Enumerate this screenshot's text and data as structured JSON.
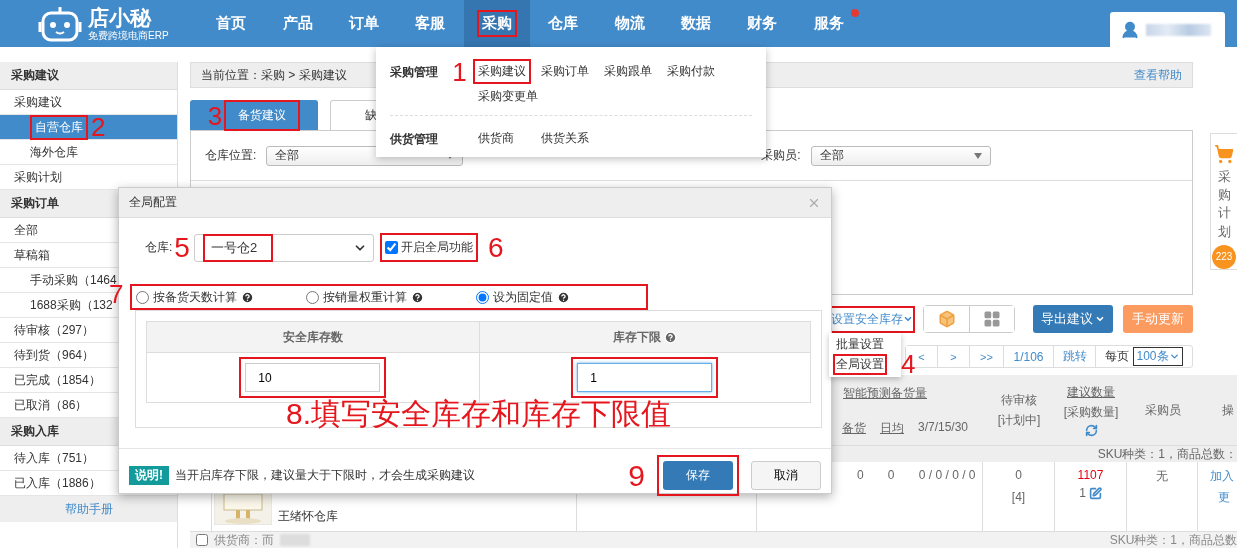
{
  "header": {
    "logo": {
      "name": "店小秘",
      "tagline": "免费跨境电商ERP"
    },
    "nav": [
      {
        "label": "首页",
        "selected": false,
        "annotated": false,
        "dot": false
      },
      {
        "label": "产品",
        "selected": false,
        "annotated": false,
        "dot": false
      },
      {
        "label": "订单",
        "selected": false,
        "annotated": false,
        "dot": false
      },
      {
        "label": "客服",
        "selected": false,
        "annotated": false,
        "dot": false
      },
      {
        "label": "采购",
        "selected": true,
        "annotated": true,
        "dot": false
      },
      {
        "label": "仓库",
        "selected": false,
        "annotated": false,
        "dot": false
      },
      {
        "label": "物流",
        "selected": false,
        "annotated": false,
        "dot": false
      },
      {
        "label": "数据",
        "selected": false,
        "annotated": false,
        "dot": false
      },
      {
        "label": "财务",
        "selected": false,
        "annotated": false,
        "dot": false
      },
      {
        "label": "服务",
        "selected": false,
        "annotated": false,
        "dot": true
      }
    ]
  },
  "nav_menu": {
    "groups": [
      {
        "title": "采购管理",
        "step": "1",
        "items": [
          {
            "label": "采购建议",
            "annotated": true
          },
          {
            "label": "采购订单",
            "annotated": false
          },
          {
            "label": "采购跟单",
            "annotated": false
          },
          {
            "label": "采购付款",
            "annotated": false
          },
          {
            "label": "采购变更单",
            "annotated": false
          }
        ]
      },
      {
        "title": "供货管理",
        "items": [
          {
            "label": "供货商",
            "annotated": false
          },
          {
            "label": "供货关系",
            "annotated": false
          }
        ]
      }
    ]
  },
  "sidebar": {
    "sections": [
      {
        "title": "采购建议",
        "items": [
          {
            "label": "采购建议",
            "selected": false,
            "annotated": false,
            "children": [
              {
                "label": "自营仓库",
                "selected": true,
                "annotated": true,
                "step": "2"
              },
              {
                "label": "海外仓库",
                "selected": false,
                "annotated": false
              }
            ]
          },
          {
            "label": "采购计划",
            "selected": false,
            "annotated": false
          }
        ]
      },
      {
        "title": "采购订单",
        "items": [
          {
            "label": "全部",
            "selected": false,
            "annotated": false
          },
          {
            "label": "草稿箱",
            "selected": false,
            "annotated": false,
            "children": [
              {
                "label": "手动采购（1464",
                "selected": false,
                "annotated": false
              },
              {
                "label": "1688采购（132",
                "selected": false,
                "annotated": false
              }
            ]
          },
          {
            "label": "待审核（297）",
            "selected": false,
            "annotated": false
          },
          {
            "label": "待到货（964）",
            "selected": false,
            "annotated": false
          },
          {
            "label": "已完成（1854）",
            "selected": false,
            "annotated": false
          },
          {
            "label": "已取消（86）",
            "selected": false,
            "annotated": false
          }
        ]
      },
      {
        "title": "采购入库",
        "items": [
          {
            "label": "待入库（751）",
            "selected": false,
            "annotated": false
          },
          {
            "label": "已入库（1886）",
            "selected": false,
            "annotated": false
          }
        ]
      }
    ],
    "help": "帮助手册"
  },
  "breadcrumb": {
    "text": "当前位置：采购 > 采购建议",
    "help": "查看帮助"
  },
  "tabs": [
    {
      "label": "备货建议",
      "selected": true,
      "annotated": true,
      "step": "3"
    },
    {
      "label": "缺",
      "selected": false,
      "annotated": false
    }
  ],
  "filters": [
    {
      "label": "仓库位置:",
      "value": "全部"
    },
    {
      "label": "采购员:",
      "value": "全部"
    }
  ],
  "side_float": {
    "label": "采购计划",
    "badge": "223"
  },
  "toolbar": {
    "safety_stock": {
      "label": "设置安全库存",
      "annotated": true
    },
    "export": "导出建议",
    "refresh": "手动更新"
  },
  "safety_menu": [
    {
      "label": "批量设置",
      "annotated": false
    },
    {
      "label": "全局设置",
      "annotated": true,
      "step": "4"
    }
  ],
  "pagination": {
    "buttons": [
      "<",
      ">",
      ">>"
    ],
    "page": "1/106",
    "jump": "跳转",
    "per_page_label": "每页",
    "per_page": "100条"
  },
  "table": {
    "forecast": {
      "title": "智能预测备货量",
      "subs": [
        "备货",
        "日均",
        "3/7/15/30"
      ]
    },
    "columns": [
      {
        "label": "待审核",
        "sub": "[计划中]",
        "refresh": false,
        "underline": false
      },
      {
        "label": "建议数量",
        "sub": "[采购数量]",
        "refresh": true,
        "underline": true
      },
      {
        "label": "采购员",
        "refresh": false,
        "underline": false
      },
      {
        "label": "操",
        "refresh": false,
        "underline": false
      }
    ],
    "summary": "SKU种类：1，商品总数：",
    "row": {
      "warehouse": "王绪怀仓库",
      "forecast": [
        "0",
        "0",
        "0 / 0 / 0 / 0"
      ],
      "pending": "0",
      "pending_plan": "[4]",
      "suggested": "1107",
      "purchase": "1",
      "buyer": "无",
      "actions": [
        "加入",
        "更"
      ]
    },
    "footer": {
      "checked": false,
      "supplier": "供货商：而",
      "summary": "SKU种类：1，商品总数"
    }
  },
  "dialog": {
    "title": "全局配置",
    "warehouse_label": "仓库:",
    "warehouse_step": "5",
    "warehouse": {
      "value": "一号仓2",
      "annotated": true
    },
    "enable": {
      "label": "开启全局功能",
      "checked": true,
      "annotated": true,
      "step": "6"
    },
    "methods_step": "7",
    "methods_annotated": true,
    "methods": [
      {
        "label": "按备货天数计算",
        "selected": false
      },
      {
        "label": "按销量权重计算",
        "selected": false
      },
      {
        "label": "设为固定值",
        "selected": true
      }
    ],
    "columns": [
      {
        "label": "安全库存数",
        "help": false,
        "value": "10",
        "focused": false,
        "annotated": true
      },
      {
        "label": "库存下限",
        "help": true,
        "value": "1",
        "focused": true,
        "annotated": true
      }
    ],
    "instruction": "8.填写安全库存和库存下限值",
    "note_badge": "说明!",
    "note": "当开启库存下限，建议量大于下限时，才会生成采购建议",
    "save_step": "9",
    "save": {
      "label": "保存",
      "annotated": true
    },
    "cancel": "取消"
  }
}
